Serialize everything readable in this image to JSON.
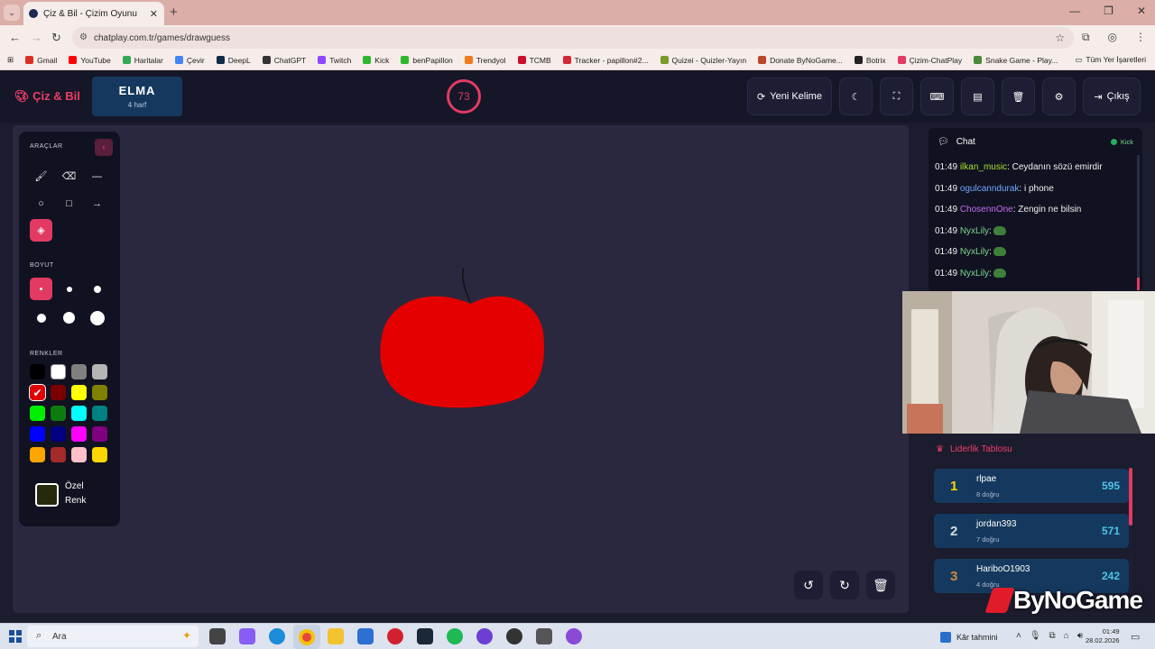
{
  "browser": {
    "tab_title": "Çiz & Bil - Çizim Oyunu",
    "url": "chatplay.com.tr/games/drawguess",
    "bookmarks": [
      {
        "label": "Gmail",
        "color": "#d93025"
      },
      {
        "label": "YouTube",
        "color": "#ff0000"
      },
      {
        "label": "Haritalar",
        "color": "#34a853"
      },
      {
        "label": "Çevir",
        "color": "#4285f4"
      },
      {
        "label": "DeepL",
        "color": "#0f2b46"
      },
      {
        "label": "ChatGPT",
        "color": "#333333"
      },
      {
        "label": "Twitch",
        "color": "#9146ff"
      },
      {
        "label": "Kick",
        "color": "#2cb82c"
      },
      {
        "label": "benPapillon",
        "color": "#2cb82c"
      },
      {
        "label": "Trendyol",
        "color": "#f27a1a"
      },
      {
        "label": "TCMB",
        "color": "#c8102e"
      },
      {
        "label": "Tracker - papillon#2...",
        "color": "#d62839"
      },
      {
        "label": "Quizei - Quizler-Yayın",
        "color": "#7a9a2a"
      },
      {
        "label": "Donate ByNoGame...",
        "color": "#b9462a"
      },
      {
        "label": "Botrix",
        "color": "#222222"
      },
      {
        "label": "Çizim-ChatPlay",
        "color": "#e23a63"
      },
      {
        "label": "Snake Game - Play...",
        "color": "#4a8a3a"
      }
    ],
    "all_bookmarks_label": "Tüm Yer İşaretleri"
  },
  "header": {
    "brand": "Çiz & Bil",
    "word": "ELMA",
    "word_hint": "4 harf",
    "timer": "73",
    "new_word_label": "Yeni Kelime",
    "exit_label": "Çıkış"
  },
  "tools": {
    "tools_label": "ARAÇLAR",
    "size_label": "BOYUT",
    "colors_label": "RENKLER",
    "custom_color_label_1": "Özel",
    "custom_color_label_2": "Renk",
    "palette": [
      "#000000",
      "#ffffff",
      "#808080",
      "#b4b4b4",
      "#e00000",
      "#7a0000",
      "#ffff00",
      "#808000",
      "#00ee00",
      "#0c7c10",
      "#00ffff",
      "#008080",
      "#0000ff",
      "#000080",
      "#ff00ff",
      "#800080",
      "#ffa500",
      "#a52a2a",
      "#ffc0cb",
      "#ffd700"
    ],
    "selected_color": "#e00000",
    "custom_color": "#262a0c"
  },
  "chat": {
    "title": "Chat",
    "platform": "Kick",
    "messages": [
      {
        "time": "01:49",
        "user": "ilkan_music",
        "user_color": "#a6e22e",
        "text": ": Ceydanın sözü emirdir"
      },
      {
        "time": "01:49",
        "user": "ogulcanndurak",
        "user_color": "#6ea8ff",
        "text": ": i phone"
      },
      {
        "time": "01:49",
        "user": "ChosennOne",
        "user_color": "#c56cf0",
        "text": ": Zengin ne bilsin"
      },
      {
        "time": "01:49",
        "user": "NyxLily",
        "user_color": "#7bd88f",
        "text": ":"
      },
      {
        "time": "01:49",
        "user": "NyxLily",
        "user_color": "#7bd88f",
        "text": ":"
      },
      {
        "time": "01:49",
        "user": "NyxLily",
        "user_color": "#7bd88f",
        "text": ":"
      }
    ]
  },
  "leaderboard": {
    "title": "Liderlik Tablosu",
    "rows": [
      {
        "rank": "1",
        "name": "rlpae",
        "sub": "8 doğru",
        "score": "595",
        "rank_color": "#ffd700"
      },
      {
        "rank": "2",
        "name": "jordan393",
        "sub": "7 doğru",
        "score": "571",
        "rank_color": "#d9dde5"
      },
      {
        "rank": "3",
        "name": "HariboO1903",
        "sub": "4 doğru",
        "score": "242",
        "rank_color": "#cd8a3a"
      }
    ]
  },
  "watermark": "ByNoGame",
  "taskbar": {
    "search_placeholder": "Ara",
    "weather": "Kâr tahmini",
    "time": "01:49",
    "date": "28.02.2026"
  },
  "colors": {
    "accent": "#e23a63",
    "apple": "#e50000",
    "canvas": "#2a283e"
  }
}
